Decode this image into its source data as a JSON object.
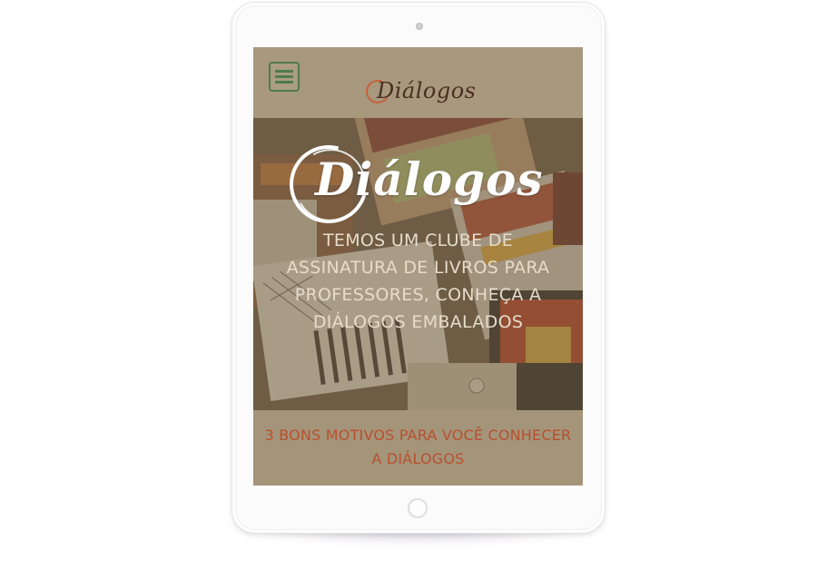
{
  "header": {
    "menu_icon": "hamburger-icon",
    "logo_text": "Diálogos"
  },
  "hero": {
    "logo_text": "Diálogos",
    "tagline": "TEMOS UM CLUBE DE ASSINATURA DE LIVROS PARA PROFESSORES, CONHEÇA A DIÁLOGOS EMBALADOS"
  },
  "motivos": {
    "heading": "3 BONS MOTIVOS PARA VOCÊ CONHECER A DIÁLOGOS"
  },
  "colors": {
    "screen_bg": "#a4947a",
    "menu_green": "#4f7a4a",
    "accent_orange": "#b8502e",
    "logo_brown": "#4a2f22"
  }
}
